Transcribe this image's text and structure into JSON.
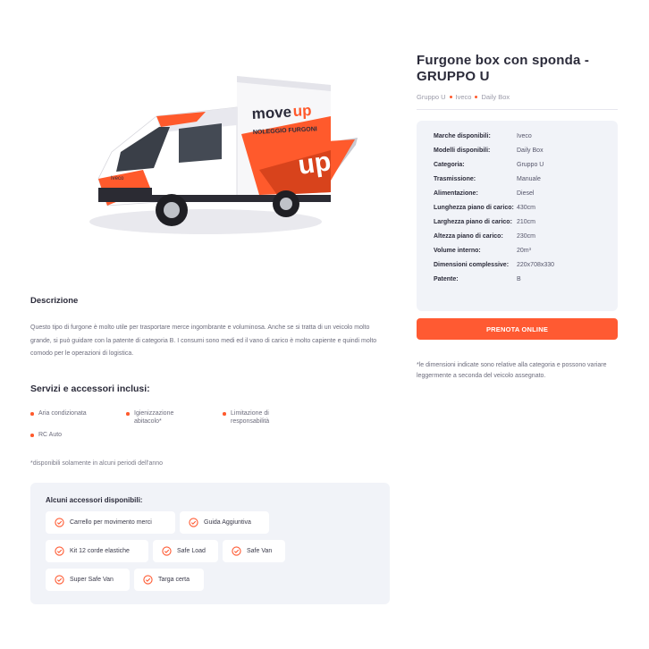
{
  "product": {
    "title_line1": "Furgone box con sponda -",
    "title_line2": "GRUPPO U",
    "breadcrumb": [
      "Gruppo U",
      "Iveco",
      "Daily Box"
    ],
    "hero_image": {
      "logo_word1": "move",
      "logo_word2": "up",
      "tagline": "NOLEGGIO FURGONI",
      "brand_badge": "Iveco"
    }
  },
  "specs": [
    {
      "label": "Marche disponibili:",
      "value": "Iveco"
    },
    {
      "label": "Modelli disponibili:",
      "value": "Daily Box"
    },
    {
      "label": "Categoria:",
      "value": "Gruppo U"
    },
    {
      "label": "Trasmissione:",
      "value": "Manuale"
    },
    {
      "label": "Alimentazione:",
      "value": "Diesel"
    },
    {
      "label": "Lunghezza piano di carico:",
      "value": "430cm"
    },
    {
      "label": "Larghezza piano di carico:",
      "value": "210cm"
    },
    {
      "label": "Altezza piano di carico:",
      "value": "230cm"
    },
    {
      "label": "Volume interno:",
      "value": "20m³"
    },
    {
      "label": "Dimensioni complessive:",
      "value": "220x708x330"
    },
    {
      "label": "Patente:",
      "value": "B"
    }
  ],
  "cta": {
    "label": "PRENOTA ONLINE"
  },
  "note_right": "*le dimensioni indicate sono relative alla categoria e possono variare leggermente a seconda del veicolo assegnato.",
  "description": {
    "heading": "Descrizione",
    "text": "Questo tipo di furgone è molto utile per trasportare merce ingombrante e voluminosa. Anche se si tratta di un veicolo molto grande, si può guidare con la patente di categoria B. I consumi sono medi ed il vano di carico è molto capiente e quindi molto comodo per le operazioni di logistica."
  },
  "services": {
    "heading": "Servizi e accessori inclusi:",
    "items": [
      "Aria condizionata",
      "Igienizzazione abitacolo*",
      "Limitazione di responsabilità",
      "RC Auto"
    ],
    "note": "*disponibili solamente in alcuni periodi dell'anno"
  },
  "accessories": {
    "heading": "Alcuni accessori disponibili:",
    "items": [
      "Carrello per movimento merci",
      "Guida Aggiuntiva",
      "Kit 12 corde elastiche",
      "Safe Load",
      "Safe Van",
      "Super Safe Van",
      "Targa certa"
    ]
  },
  "colors": {
    "accent": "#ff5a32",
    "panel": "#f1f3f8",
    "text": "#2b2b3a",
    "muted": "#6c6c7c"
  }
}
